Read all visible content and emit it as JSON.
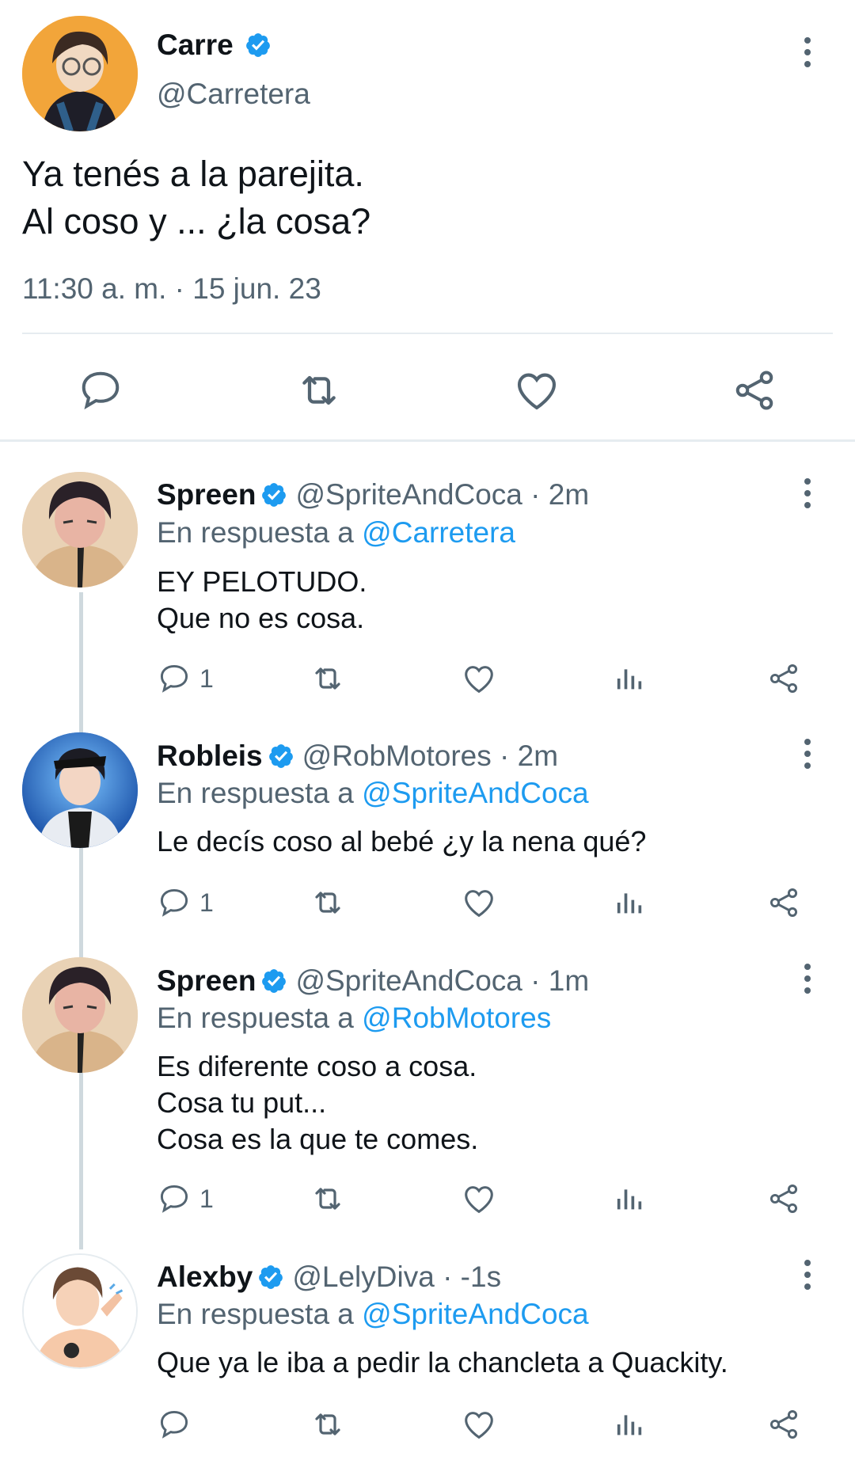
{
  "main_tweet": {
    "author_name": "Carre",
    "author_handle": "@Carretera",
    "text_line1": "Ya tenés a la parejita.",
    "text_line2": "Al coso y ... ¿la cosa?",
    "timestamp": "11:30 a. m. · 15 jun. 23",
    "icons": [
      "reply-icon",
      "retweet-icon",
      "like-icon",
      "share-icon"
    ]
  },
  "replies": [
    {
      "name": "Spreen",
      "handle": "@SpriteAndCoca · 2m",
      "reply_prefix": "En respuesta a",
      "reply_to": "@Carretera",
      "text": "EY PELOTUDO.\nQue no es cosa.",
      "reply_count": "1"
    },
    {
      "name": "Robleis",
      "handle": "@RobMotores · 2m",
      "reply_prefix": "En respuesta a",
      "reply_to": "@SpriteAndCoca",
      "text": "Le decís coso al bebé ¿y la nena qué?",
      "reply_count": "1"
    },
    {
      "name": "Spreen",
      "handle": "@SpriteAndCoca · 1m",
      "reply_prefix": "En respuesta a",
      "reply_to": "@RobMotores",
      "text": "Es diferente coso a cosa.\nCosa tu put...\nCosa es la que te comes.",
      "reply_count": "1"
    },
    {
      "name": "Alexby",
      "handle": "@LelyDiva · -1s",
      "reply_prefix": "En respuesta a",
      "reply_to": "@SpriteAndCoca",
      "text": "Que ya le iba a pedir la chancleta a Quackity.",
      "reply_count": ""
    }
  ],
  "colors": {
    "accent": "#1d9bf0",
    "secondary_text": "#536471",
    "primary_text": "#0f1419",
    "divider": "#e6ecf0"
  }
}
